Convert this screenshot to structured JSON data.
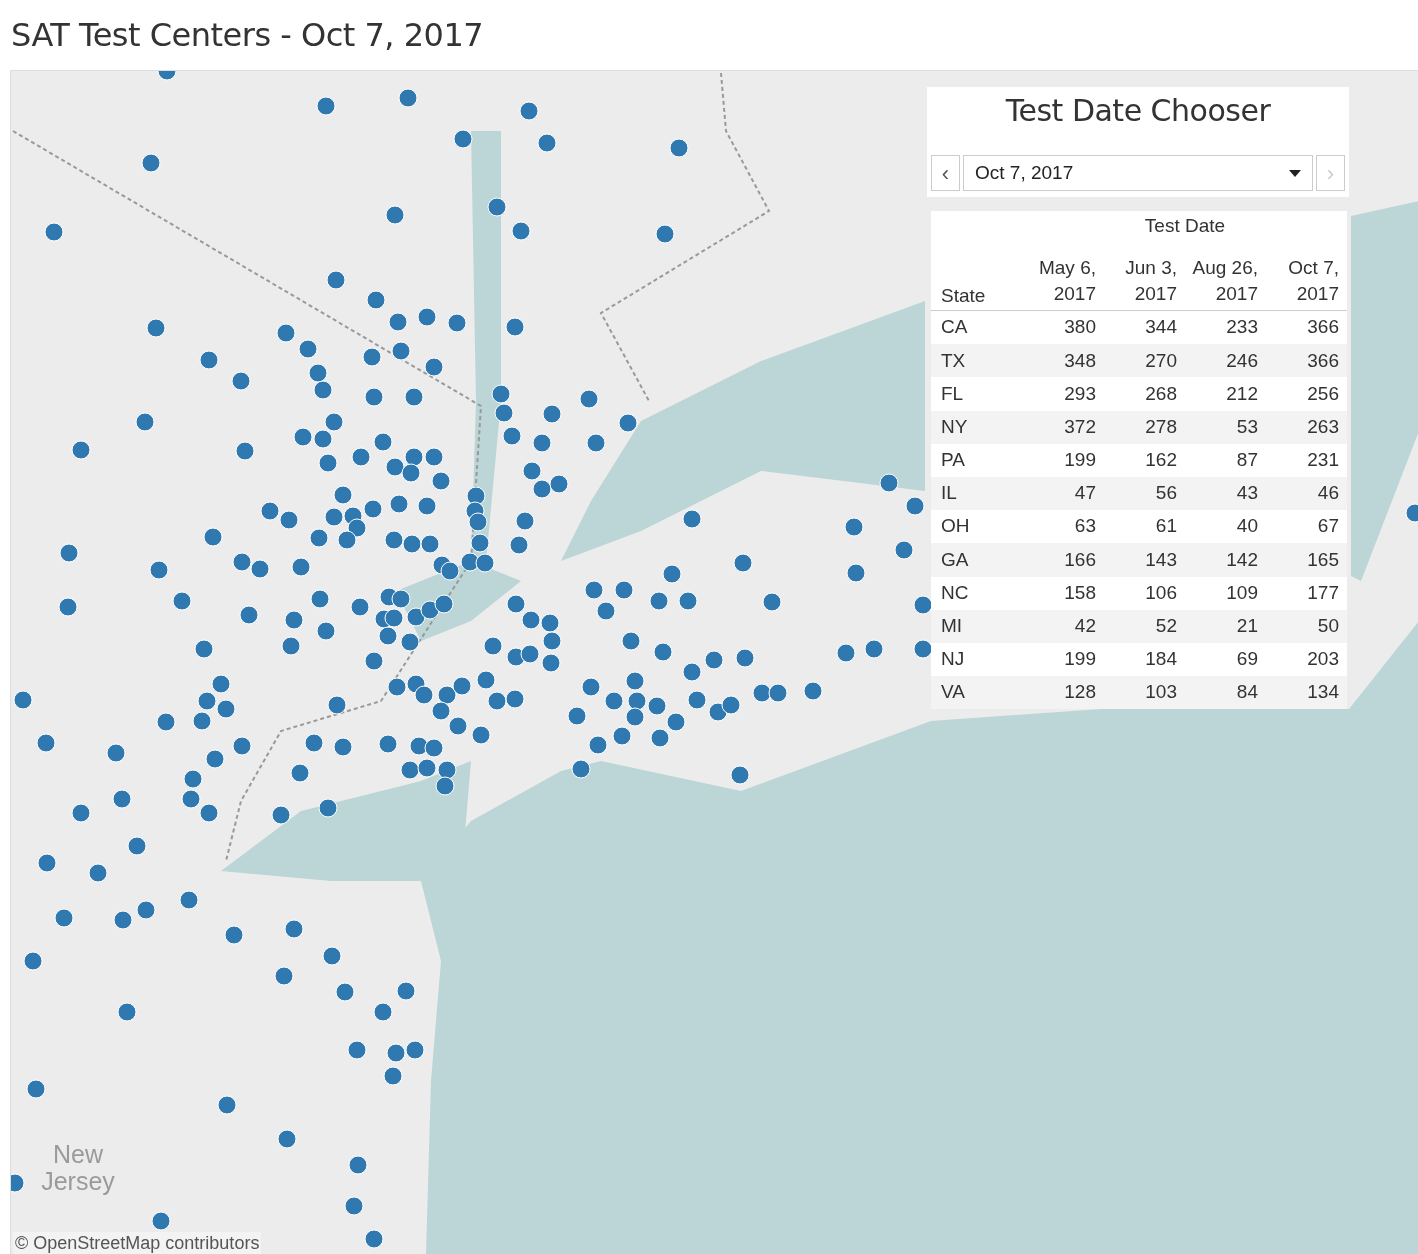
{
  "title": "SAT Test Centers - Oct 7, 2017",
  "map": {
    "region_label": "New Jersey",
    "attribution": "© OpenStreetMap contributors"
  },
  "chooser": {
    "title": "Test Date Chooser",
    "value": "Oct 7, 2017",
    "prev": {
      "label": "‹",
      "disabled": false
    },
    "next": {
      "label": "›",
      "disabled": true
    }
  },
  "table": {
    "group_heading": "Test Date",
    "columns": [
      "State",
      "May 6, 2017",
      "Jun 3, 2017",
      "Aug 26, 2017",
      "Oct 7, 2017"
    ],
    "rows": [
      [
        "CA",
        "380",
        "344",
        "233",
        "366"
      ],
      [
        "TX",
        "348",
        "270",
        "246",
        "366"
      ],
      [
        "FL",
        "293",
        "268",
        "212",
        "256"
      ],
      [
        "NY",
        "372",
        "278",
        "53",
        "263"
      ],
      [
        "PA",
        "199",
        "162",
        "87",
        "231"
      ],
      [
        "IL",
        "47",
        "56",
        "43",
        "46"
      ],
      [
        "OH",
        "63",
        "61",
        "40",
        "67"
      ],
      [
        "GA",
        "166",
        "143",
        "142",
        "165"
      ],
      [
        "NC",
        "158",
        "106",
        "109",
        "177"
      ],
      [
        "MI",
        "42",
        "52",
        "21",
        "50"
      ],
      [
        "NJ",
        "199",
        "184",
        "69",
        "203"
      ],
      [
        "VA",
        "128",
        "103",
        "84",
        "134"
      ]
    ]
  }
}
